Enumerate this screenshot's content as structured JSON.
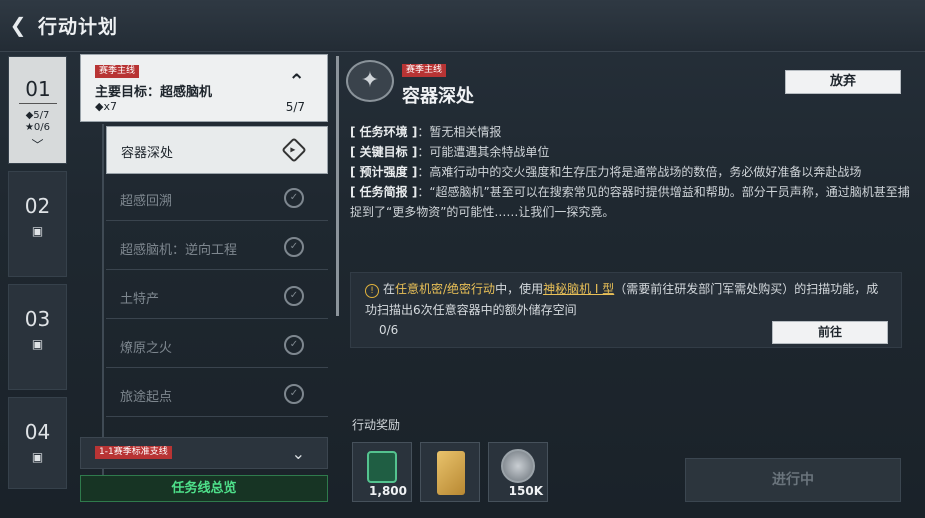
{
  "header": {
    "title": "行动计划"
  },
  "nav": [
    {
      "num": "01",
      "stat1": "◆5/7",
      "stat2": "★0/6",
      "chev": "﹀"
    },
    {
      "num": "02",
      "lock": "🔒"
    },
    {
      "num": "03",
      "lock": "🔒"
    },
    {
      "num": "04",
      "lock": "🔒"
    }
  ],
  "main_card": {
    "tag": "赛季主线",
    "title": "主要目标：超感脑机",
    "reward": "◆x7",
    "progress": "5/7"
  },
  "subs": [
    {
      "label": "容器深处"
    },
    {
      "label": "超感回溯"
    },
    {
      "label": "超感脑机：逆向工程"
    },
    {
      "label": "土特产"
    },
    {
      "label": "燎原之火"
    },
    {
      "label": "旅途起点"
    }
  ],
  "secondary_card": {
    "tag": "1-1赛季标准支线"
  },
  "overview_label": "任务线总览",
  "detail": {
    "tag": "赛季主线",
    "title": "容器深处",
    "abandon_label": "放弃",
    "env_label": "[ 任务环境 ]",
    "env_value": "：暂无相关情报",
    "target_label": "[ 关键目标 ]",
    "target_value": "：可能遭遇其余特战单位",
    "intensity_label": "[ 预计强度 ]",
    "intensity_value": "：高难行动中的交火强度和生存压力将是通常战场的数倍，务必做好准备以奔赴战场",
    "brief_label": "[ 任务简报 ]",
    "brief_value": "：“超感脑机”甚至可以在搜索常见的容器时提供增益和帮助。部分干员声称，通过脑机甚至捕捉到了“更多物资”的可能性……让我们一探究竟。",
    "obj_prefix": "在",
    "obj_mode": "任意机密/绝密行动",
    "obj_mid": "中，使用",
    "obj_item": "神秘脑机 I 型",
    "obj_rest": "（需要前往研发部门军需处购买）的扫描功能，成功扫描出6次任意容器中的额外储存空间",
    "obj_progress": "0/6",
    "goto_label": "前往",
    "rewards_label": "行动奖励",
    "rewards": [
      {
        "value": "1,800"
      },
      {
        "value": ""
      },
      {
        "value": "150K"
      }
    ],
    "status_label": "进行中"
  }
}
